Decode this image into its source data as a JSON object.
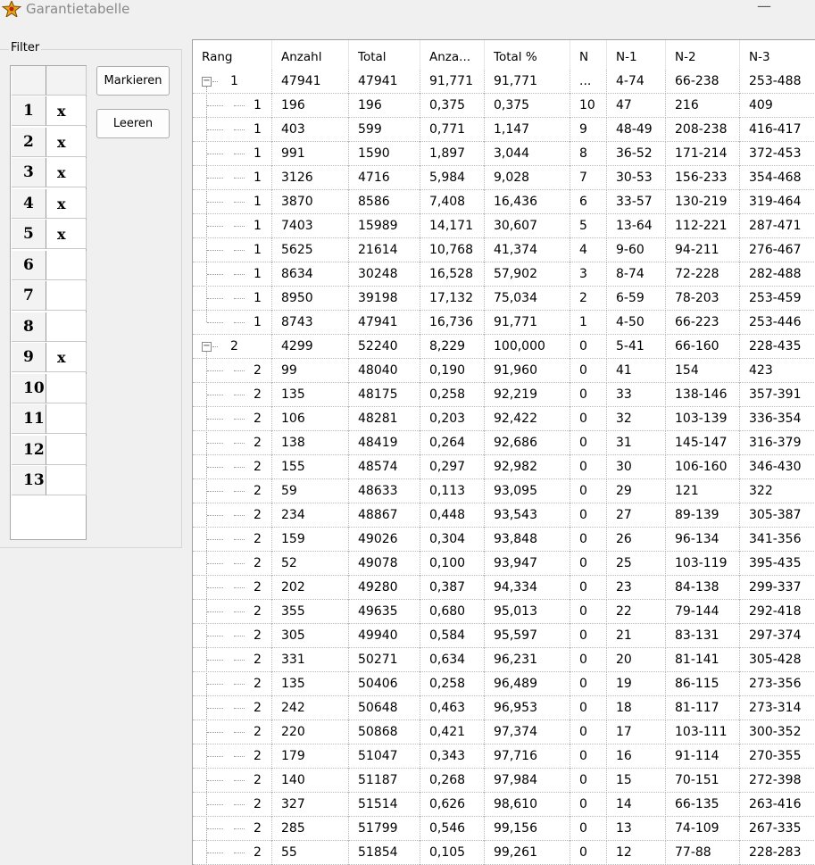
{
  "window": {
    "title": "Garantietabelle",
    "minimize_glyph": "—"
  },
  "filter": {
    "label": "Filter",
    "buttons": {
      "mark": "Markieren",
      "clear": "Leeren"
    },
    "rows": [
      {
        "num": "1",
        "mark": "x"
      },
      {
        "num": "2",
        "mark": "x"
      },
      {
        "num": "3",
        "mark": "x"
      },
      {
        "num": "4",
        "mark": "x"
      },
      {
        "num": "5",
        "mark": "x"
      },
      {
        "num": "6",
        "mark": ""
      },
      {
        "num": "7",
        "mark": ""
      },
      {
        "num": "8",
        "mark": ""
      },
      {
        "num": "9",
        "mark": "x"
      },
      {
        "num": "10",
        "mark": ""
      },
      {
        "num": "11",
        "mark": ""
      },
      {
        "num": "12",
        "mark": ""
      },
      {
        "num": "13",
        "mark": ""
      }
    ]
  },
  "table": {
    "columns": [
      "Rang",
      "Anzahl",
      "Total",
      "Anza...",
      "Total %",
      "N",
      "N-1",
      "N-2",
      "N-3"
    ],
    "rows": [
      {
        "level": 0,
        "expander": "⊟",
        "rang": "1",
        "cells": [
          "47941",
          "47941",
          "91,771",
          "91,771",
          "...",
          "4-74",
          "66-238",
          "253-488"
        ]
      },
      {
        "level": 1,
        "rang": "1",
        "cells": [
          "196",
          "196",
          "0,375",
          "0,375",
          "10",
          "47",
          "216",
          "409"
        ]
      },
      {
        "level": 1,
        "rang": "1",
        "cells": [
          "403",
          "599",
          "0,771",
          "1,147",
          "9",
          "48-49",
          "208-238",
          "416-417"
        ]
      },
      {
        "level": 1,
        "rang": "1",
        "cells": [
          "991",
          "1590",
          "1,897",
          "3,044",
          "8",
          "36-52",
          "171-214",
          "372-453"
        ]
      },
      {
        "level": 1,
        "rang": "1",
        "cells": [
          "3126",
          "4716",
          "5,984",
          "9,028",
          "7",
          "30-53",
          "156-233",
          "354-468"
        ]
      },
      {
        "level": 1,
        "rang": "1",
        "cells": [
          "3870",
          "8586",
          "7,408",
          "16,436",
          "6",
          "33-57",
          "130-219",
          "319-464"
        ]
      },
      {
        "level": 1,
        "rang": "1",
        "cells": [
          "7403",
          "15989",
          "14,171",
          "30,607",
          "5",
          "13-64",
          "112-221",
          "287-471"
        ]
      },
      {
        "level": 1,
        "rang": "1",
        "cells": [
          "5625",
          "21614",
          "10,768",
          "41,374",
          "4",
          "9-60",
          "94-211",
          "276-467"
        ]
      },
      {
        "level": 1,
        "rang": "1",
        "cells": [
          "8634",
          "30248",
          "16,528",
          "57,902",
          "3",
          "8-74",
          "72-228",
          "282-488"
        ]
      },
      {
        "level": 1,
        "rang": "1",
        "cells": [
          "8950",
          "39198",
          "17,132",
          "75,034",
          "2",
          "6-59",
          "78-203",
          "253-459"
        ]
      },
      {
        "level": 1,
        "rang": "1",
        "last": true,
        "cells": [
          "8743",
          "47941",
          "16,736",
          "91,771",
          "1",
          "4-50",
          "66-223",
          "253-446"
        ]
      },
      {
        "level": 0,
        "expander": "⊟",
        "rang": "2",
        "cells": [
          "4299",
          "52240",
          "8,229",
          "100,000",
          "0",
          "5-41",
          "66-160",
          "228-435"
        ]
      },
      {
        "level": 1,
        "rang": "2",
        "cells": [
          "99",
          "48040",
          "0,190",
          "91,960",
          "0",
          "41",
          "154",
          "423"
        ]
      },
      {
        "level": 1,
        "rang": "2",
        "cells": [
          "135",
          "48175",
          "0,258",
          "92,219",
          "0",
          "33",
          "138-146",
          "357-391"
        ]
      },
      {
        "level": 1,
        "rang": "2",
        "cells": [
          "106",
          "48281",
          "0,203",
          "92,422",
          "0",
          "32",
          "103-139",
          "336-354"
        ]
      },
      {
        "level": 1,
        "rang": "2",
        "cells": [
          "138",
          "48419",
          "0,264",
          "92,686",
          "0",
          "31",
          "145-147",
          "316-379"
        ]
      },
      {
        "level": 1,
        "rang": "2",
        "cells": [
          "155",
          "48574",
          "0,297",
          "92,982",
          "0",
          "30",
          "106-160",
          "346-430"
        ]
      },
      {
        "level": 1,
        "rang": "2",
        "cells": [
          "59",
          "48633",
          "0,113",
          "93,095",
          "0",
          "29",
          "121",
          "322"
        ]
      },
      {
        "level": 1,
        "rang": "2",
        "cells": [
          "234",
          "48867",
          "0,448",
          "93,543",
          "0",
          "27",
          "89-139",
          "305-387"
        ]
      },
      {
        "level": 1,
        "rang": "2",
        "cells": [
          "159",
          "49026",
          "0,304",
          "93,848",
          "0",
          "26",
          "96-134",
          "341-356"
        ]
      },
      {
        "level": 1,
        "rang": "2",
        "cells": [
          "52",
          "49078",
          "0,100",
          "93,947",
          "0",
          "25",
          "103-119",
          "395-435"
        ]
      },
      {
        "level": 1,
        "rang": "2",
        "cells": [
          "202",
          "49280",
          "0,387",
          "94,334",
          "0",
          "23",
          "84-138",
          "299-337"
        ]
      },
      {
        "level": 1,
        "rang": "2",
        "cells": [
          "355",
          "49635",
          "0,680",
          "95,013",
          "0",
          "22",
          "79-144",
          "292-418"
        ]
      },
      {
        "level": 1,
        "rang": "2",
        "cells": [
          "305",
          "49940",
          "0,584",
          "95,597",
          "0",
          "21",
          "83-131",
          "297-374"
        ]
      },
      {
        "level": 1,
        "rang": "2",
        "cells": [
          "331",
          "50271",
          "0,634",
          "96,231",
          "0",
          "20",
          "81-141",
          "305-428"
        ]
      },
      {
        "level": 1,
        "rang": "2",
        "cells": [
          "135",
          "50406",
          "0,258",
          "96,489",
          "0",
          "19",
          "86-115",
          "273-356"
        ]
      },
      {
        "level": 1,
        "rang": "2",
        "cells": [
          "242",
          "50648",
          "0,463",
          "96,953",
          "0",
          "18",
          "81-117",
          "273-314"
        ]
      },
      {
        "level": 1,
        "rang": "2",
        "cells": [
          "220",
          "50868",
          "0,421",
          "97,374",
          "0",
          "17",
          "103-111",
          "300-352"
        ]
      },
      {
        "level": 1,
        "rang": "2",
        "cells": [
          "179",
          "51047",
          "0,343",
          "97,716",
          "0",
          "16",
          "91-114",
          "270-355"
        ]
      },
      {
        "level": 1,
        "rang": "2",
        "cells": [
          "140",
          "51187",
          "0,268",
          "97,984",
          "0",
          "15",
          "70-151",
          "272-398"
        ]
      },
      {
        "level": 1,
        "rang": "2",
        "cells": [
          "327",
          "51514",
          "0,626",
          "98,610",
          "0",
          "14",
          "66-135",
          "263-416"
        ]
      },
      {
        "level": 1,
        "rang": "2",
        "cells": [
          "285",
          "51799",
          "0,546",
          "99,156",
          "0",
          "13",
          "74-109",
          "267-335"
        ]
      },
      {
        "level": 1,
        "rang": "2",
        "cells": [
          "55",
          "51854",
          "0,105",
          "99,261",
          "0",
          "12",
          "77-88",
          "228-283"
        ]
      }
    ]
  }
}
